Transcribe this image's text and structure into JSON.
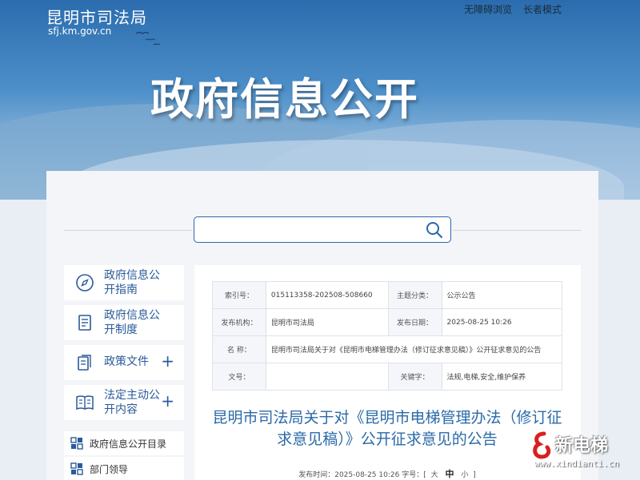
{
  "header": {
    "site_name": "昆明市司法局",
    "site_url": "sfj.km.gov.cn",
    "links": [
      "无障碍浏览",
      "长者模式"
    ],
    "banner_title": "政府信息公开"
  },
  "search": {
    "placeholder": "",
    "value": ""
  },
  "sidebar": {
    "items": [
      {
        "label": "政府信息公开指南",
        "icon": "compass-icon",
        "expandable": false
      },
      {
        "label": "政府信息公开制度",
        "icon": "document-icon",
        "expandable": false
      },
      {
        "label": "政策文件",
        "icon": "file-icon",
        "expandable": true,
        "expand_symbol": "+"
      },
      {
        "label": "法定主动公开内容",
        "icon": "book-icon",
        "expandable": true,
        "expand_symbol": "+"
      }
    ],
    "sub_items": [
      {
        "label": "政府信息公开目录",
        "icon": "grid-icon"
      },
      {
        "label": "部门领导",
        "icon": "grid-icon"
      }
    ]
  },
  "meta_table": {
    "rows": [
      [
        {
          "k": "索引号："
        },
        {
          "v": "015113358-202508-508660"
        },
        {
          "k": "主题分类："
        },
        {
          "v": "公示公告"
        }
      ],
      [
        {
          "k": "发布机构："
        },
        {
          "v": "昆明市司法局"
        },
        {
          "k": "发布日期："
        },
        {
          "v": "2025-08-25 10:26"
        }
      ],
      [
        {
          "k": "名 称："
        },
        {
          "v": "昆明市司法局关于对《昆明市电梯管理办法（修订征求意见稿）》公开征求意见的公告"
        }
      ],
      [
        {
          "k": "文号："
        },
        {
          "v": ""
        },
        {
          "k": "关键字："
        },
        {
          "v": "法规,电梯,安全,维护保养"
        }
      ]
    ]
  },
  "article": {
    "title": "昆明市司法局关于对《昆明市电梯管理办法（修订征求意见稿）》公开征求意见的公告",
    "publish_prefix": "发布时间：2025-08-25 10:26 字号：[",
    "size_large": "大",
    "size_medium": "中",
    "size_small": "小",
    "publish_suffix": "]"
  },
  "watermark": {
    "name": "新电梯",
    "url": "www.xindianti.cn"
  }
}
